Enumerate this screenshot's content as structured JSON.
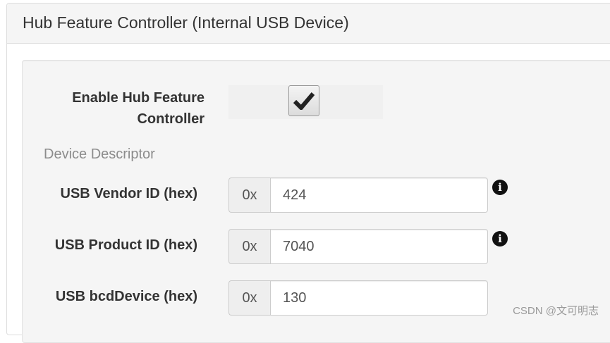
{
  "panel": {
    "title": "Hub Feature Controller (Internal USB Device)"
  },
  "enable": {
    "label": "Enable Hub Feature Controller",
    "checked": true
  },
  "descriptor": {
    "section_title": "Device Descriptor",
    "fields": [
      {
        "label": "USB Vendor ID (hex)",
        "prefix": "0x",
        "value": "424",
        "has_info": true
      },
      {
        "label": "USB Product ID (hex)",
        "prefix": "0x",
        "value": "7040",
        "has_info": true
      },
      {
        "label": "USB bcdDevice (hex)",
        "prefix": "0x",
        "value": "130",
        "has_info": false
      }
    ]
  },
  "icons": {
    "info": "info-icon",
    "checkmark": "checkmark-icon"
  },
  "watermark": "CSDN @文可明志",
  "colors": {
    "heading_bg": "#f5f5f5",
    "well_bg": "#f5f5f5",
    "addon_bg": "#eeeeee",
    "border": "#cccccc",
    "section_title": "#8c8c8c"
  }
}
